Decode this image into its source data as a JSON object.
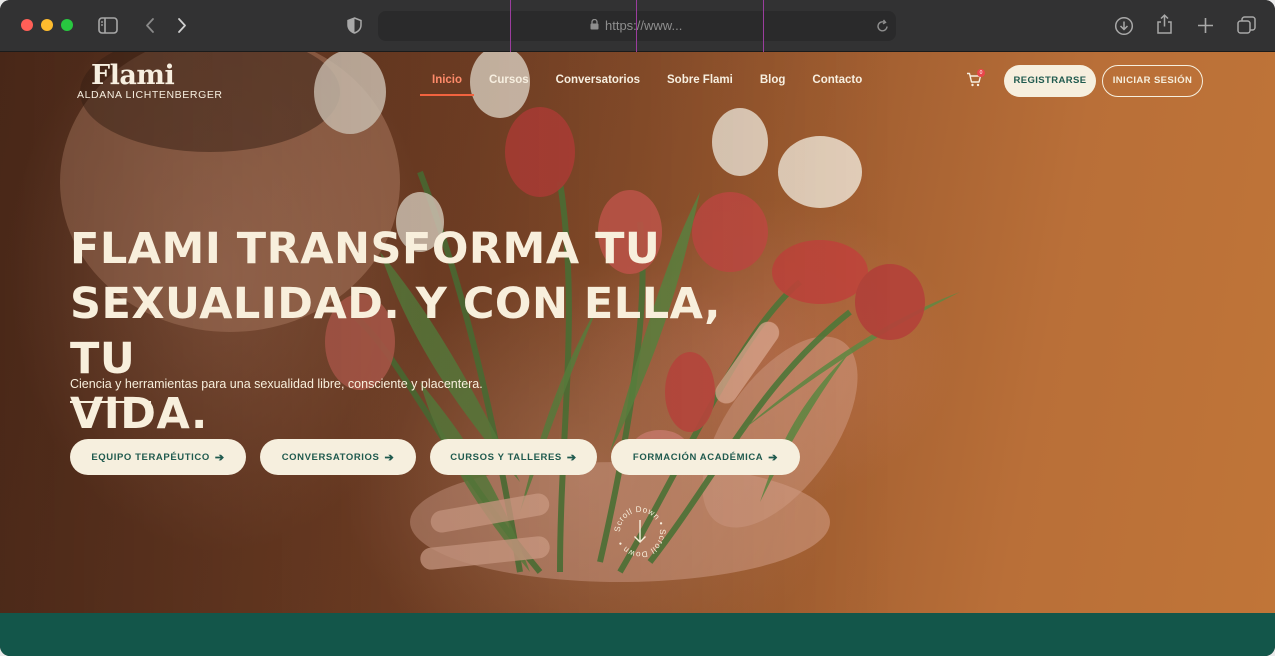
{
  "browser": {
    "url": "https://www...",
    "icons": {
      "sidebar": "sidebar-icon",
      "back": "chevron-left-icon",
      "forward": "chevron-right-icon",
      "privacy": "shield-icon",
      "lock": "lock-icon",
      "reload": "reload-icon",
      "download": "download-icon",
      "share": "share-icon",
      "new_tab": "plus-icon",
      "tabs": "tabs-icon"
    }
  },
  "site": {
    "logo": {
      "mark": "Flami",
      "subtitle": "ALDANA LICHTENBERGER"
    },
    "nav": [
      {
        "label": "Inicio",
        "active": true
      },
      {
        "label": "Cursos"
      },
      {
        "label": "Conversatorios"
      },
      {
        "label": "Sobre Flami"
      },
      {
        "label": "Blog"
      },
      {
        "label": "Contacto"
      }
    ],
    "cart": {
      "count": "0"
    },
    "register_label": "REGISTRARSE",
    "login_label": "INICIAR SESIÓN"
  },
  "hero": {
    "headline_line1": "FLAMI TRANSFORMA TU",
    "headline_line2": "SEXUALIDAD. Y CON ELLA, TU",
    "headline_line3": "VIDA.",
    "subheadline": "Ciencia y herramientas para una sexualidad libre, consciente y placentera.",
    "buttons": [
      {
        "label": "EQUIPO TERAPÉUTICO"
      },
      {
        "label": "CONVERSATORIOS"
      },
      {
        "label": "CURSOS Y TALLERES"
      },
      {
        "label": "FORMACIÓN ACADÉMICA"
      }
    ],
    "scroll_label": "Scroll Down • Scroll Down •"
  },
  "colors": {
    "accent": "#f2633f",
    "cream": "#f6efde",
    "brand_green": "#13564a",
    "button_text": "#1f5a4e"
  }
}
